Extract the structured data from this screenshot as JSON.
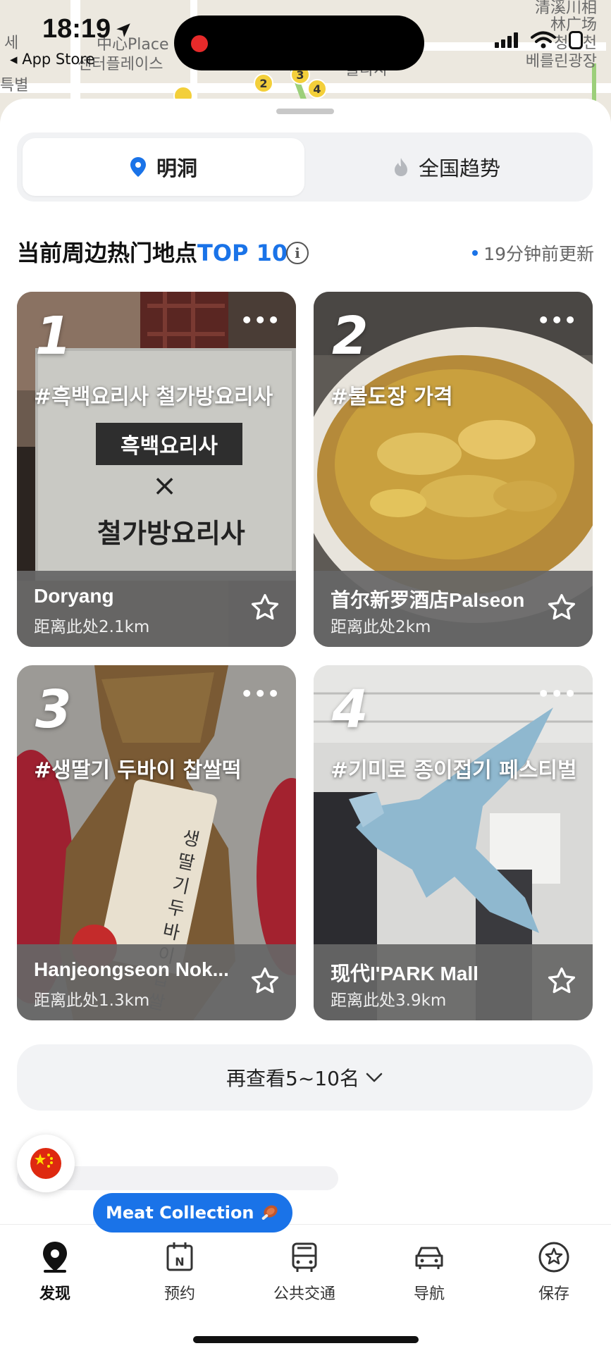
{
  "status_bar": {
    "time": "18:19",
    "back_app": "◂ App Store"
  },
  "map": {
    "labels": [
      "中心Place",
      "센터플레이스",
      "세",
      "특별",
      "清溪川相",
      "林广场",
      "청계천",
      "베를린광장",
      "플라자"
    ],
    "pins": [
      "2",
      "3",
      "4"
    ]
  },
  "tabs_segment": {
    "active": "明洞",
    "inactive": "全国趋势"
  },
  "section": {
    "title_prefix": "当前周边热门地点",
    "title_accent": "TOP 10",
    "updated": "19分钟前更新"
  },
  "cards": [
    {
      "rank": "1",
      "tag": "#흑백요리사 철가방요리사",
      "name": "Doryang",
      "distance": "距离此处2.1km"
    },
    {
      "rank": "2",
      "tag": "#불도장 가격",
      "name": "首尔新罗酒店Palseon",
      "distance": "距离此处2km"
    },
    {
      "rank": "3",
      "tag": "#생딸기 두바이 찹쌀떡",
      "name": "Hanjeongseon Nok...",
      "distance": "距离此处1.3km"
    },
    {
      "rank": "4",
      "tag": "#기미로 종이접기 페스티벌",
      "name": "现代I'PARK Mall",
      "distance": "距离此处3.9km"
    }
  ],
  "photo_text": {
    "sign_main": "흑백요리사",
    "sign_x": "×",
    "sign_sub": "철가방요리사",
    "bag_label": "생딸기두바이 찹쌀"
  },
  "more_button": "再查看5~10名",
  "promo_pill": "Meat Collection",
  "bottom_nav": [
    {
      "label": "发现",
      "icon": "location-pin-icon"
    },
    {
      "label": "预约",
      "icon": "calendar-icon"
    },
    {
      "label": "公共交通",
      "icon": "bus-icon"
    },
    {
      "label": "导航",
      "icon": "car-icon"
    },
    {
      "label": "保存",
      "icon": "star-circle-icon"
    }
  ],
  "colors": {
    "accent": "#1a73e8",
    "record": "#e62a2a",
    "flag": "#de2910"
  }
}
